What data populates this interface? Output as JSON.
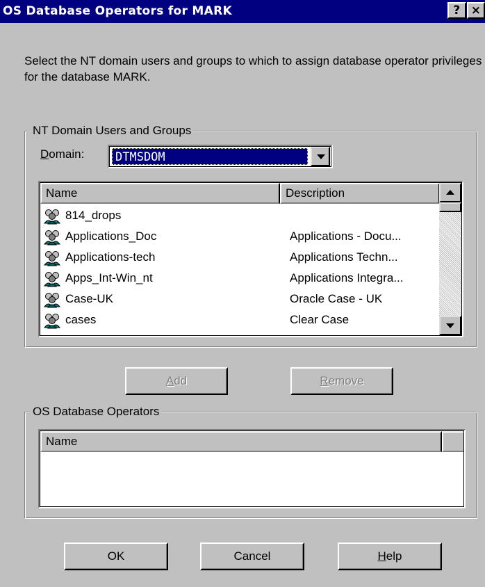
{
  "window": {
    "title": "OS Database Operators for MARK",
    "help_glyph": "?",
    "close_glyph": "×"
  },
  "instructions": "Select the NT domain users and groups to which to assign database operator privileges for the database MARK.",
  "domain_group": {
    "title": "NT Domain Users and Groups",
    "domain_label_mnemonic": "D",
    "domain_label_rest": "omain:",
    "domain_value": "DTMSDOM",
    "columns": [
      "Name",
      "Description"
    ],
    "rows": [
      {
        "name": "814_drops",
        "description": ""
      },
      {
        "name": "Applications_Doc",
        "description": "Applications - Docu..."
      },
      {
        "name": "Applications-tech",
        "description": "Applications Techn..."
      },
      {
        "name": "Apps_Int-Win_nt",
        "description": "Applications Integra..."
      },
      {
        "name": "Case-UK",
        "description": "Oracle Case - UK"
      },
      {
        "name": "cases",
        "description": "Clear Case"
      }
    ]
  },
  "buttons": {
    "add_mnemonic": "A",
    "add_rest": "dd",
    "remove_mnemonic": "R",
    "remove_rest": "emove",
    "ok": "OK",
    "cancel": "Cancel",
    "help_mnemonic": "H",
    "help_rest": "elp"
  },
  "operators_group": {
    "title": "OS Database Operators",
    "columns": [
      "Name"
    ]
  },
  "icons": {
    "group_user": "users-group-icon"
  },
  "colors": {
    "title_bar": "#000080",
    "face": "#c0c0c0",
    "selection": "#000080"
  }
}
